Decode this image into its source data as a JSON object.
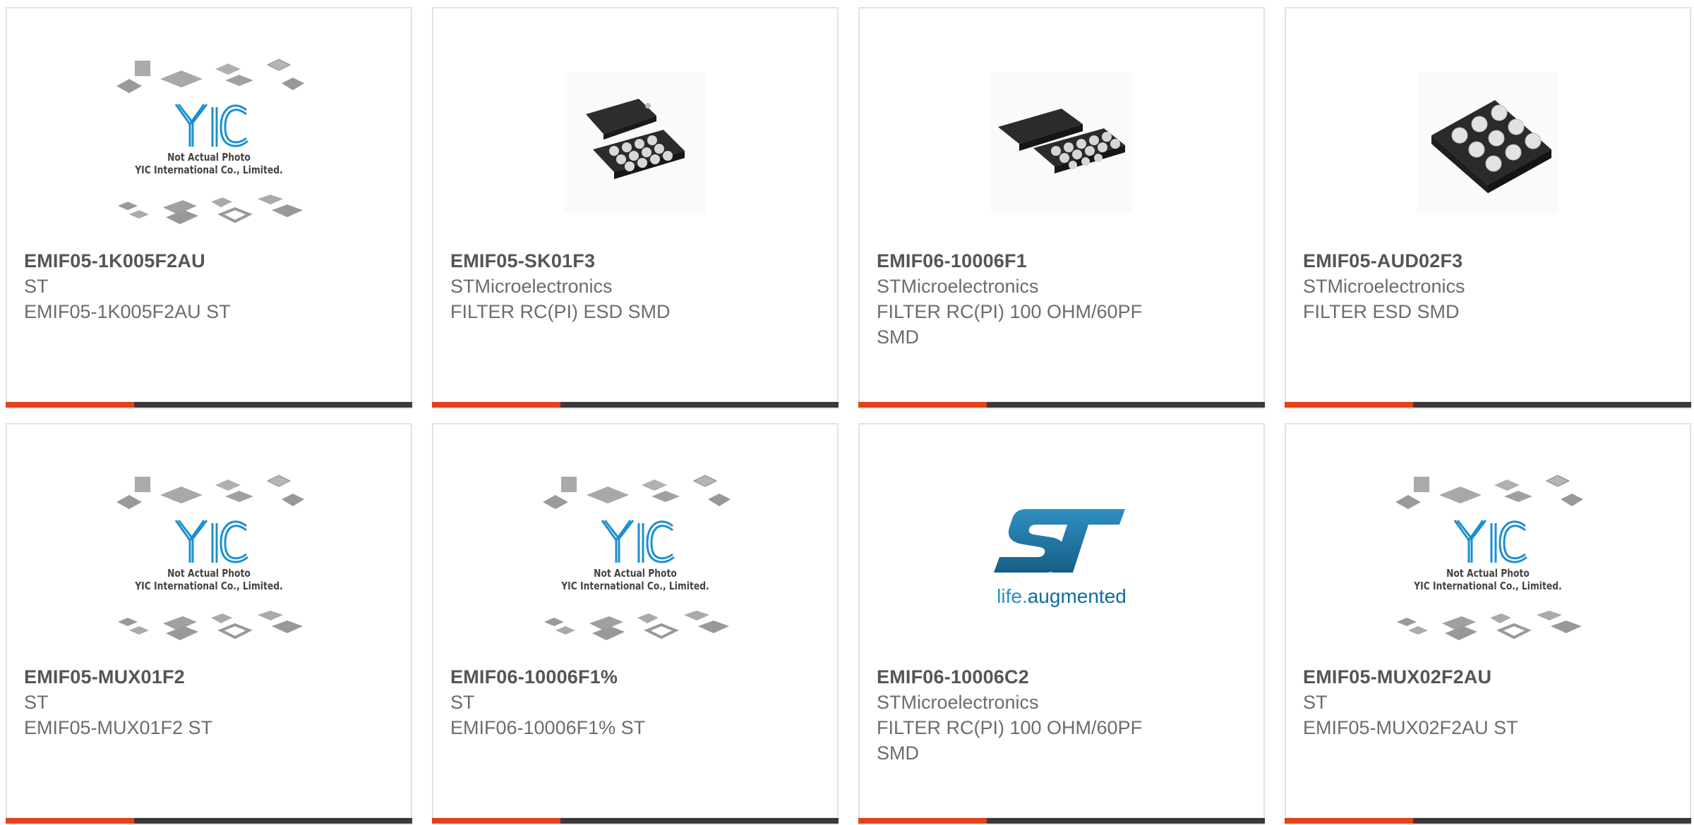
{
  "products": [
    {
      "part_number": "EMIF05-1K005F2AU",
      "manufacturer": "ST",
      "description": "EMIF05-1K005F2AU ST",
      "image": "yic-placeholder"
    },
    {
      "part_number": "EMIF05-SK01F3",
      "manufacturer": "STMicroelectronics",
      "description": "FILTER RC(PI) ESD SMD",
      "image": "bga-chip-photo"
    },
    {
      "part_number": "EMIF06-10006F1",
      "manufacturer": "STMicroelectronics",
      "description": "FILTER RC(PI) 100 OHM/60PF SMD",
      "image": "bga-chip-photo"
    },
    {
      "part_number": "EMIF05-AUD02F3",
      "manufacturer": "STMicroelectronics",
      "description": "FILTER ESD SMD",
      "image": "bga-chip-photo"
    },
    {
      "part_number": "EMIF05-MUX01F2",
      "manufacturer": "ST",
      "description": "EMIF05-MUX01F2 ST",
      "image": "yic-placeholder"
    },
    {
      "part_number": "EMIF06-10006F1%",
      "manufacturer": "ST",
      "description": "EMIF06-10006F1% ST",
      "image": "yic-placeholder"
    },
    {
      "part_number": "EMIF06-10006C2",
      "manufacturer": "STMicroelectronics",
      "description": "FILTER RC(PI) 100 OHM/60PF SMD",
      "image": "st-logo"
    },
    {
      "part_number": "EMIF05-MUX02F2AU",
      "manufacturer": "ST",
      "description": "EMIF05-MUX02F2AU ST",
      "image": "yic-placeholder"
    }
  ],
  "placeholder": {
    "logo_text": "YIC",
    "line1": "Not Actual Photo",
    "line2": "YIC International Co., Limited."
  },
  "st_logo": {
    "logo_text": "ST",
    "tagline_a": "life.",
    "tagline_b": "augmented"
  },
  "colors": {
    "accent": "#e2421a",
    "bar": "#3a3a3a",
    "st_blue": "#1c6f9a"
  }
}
